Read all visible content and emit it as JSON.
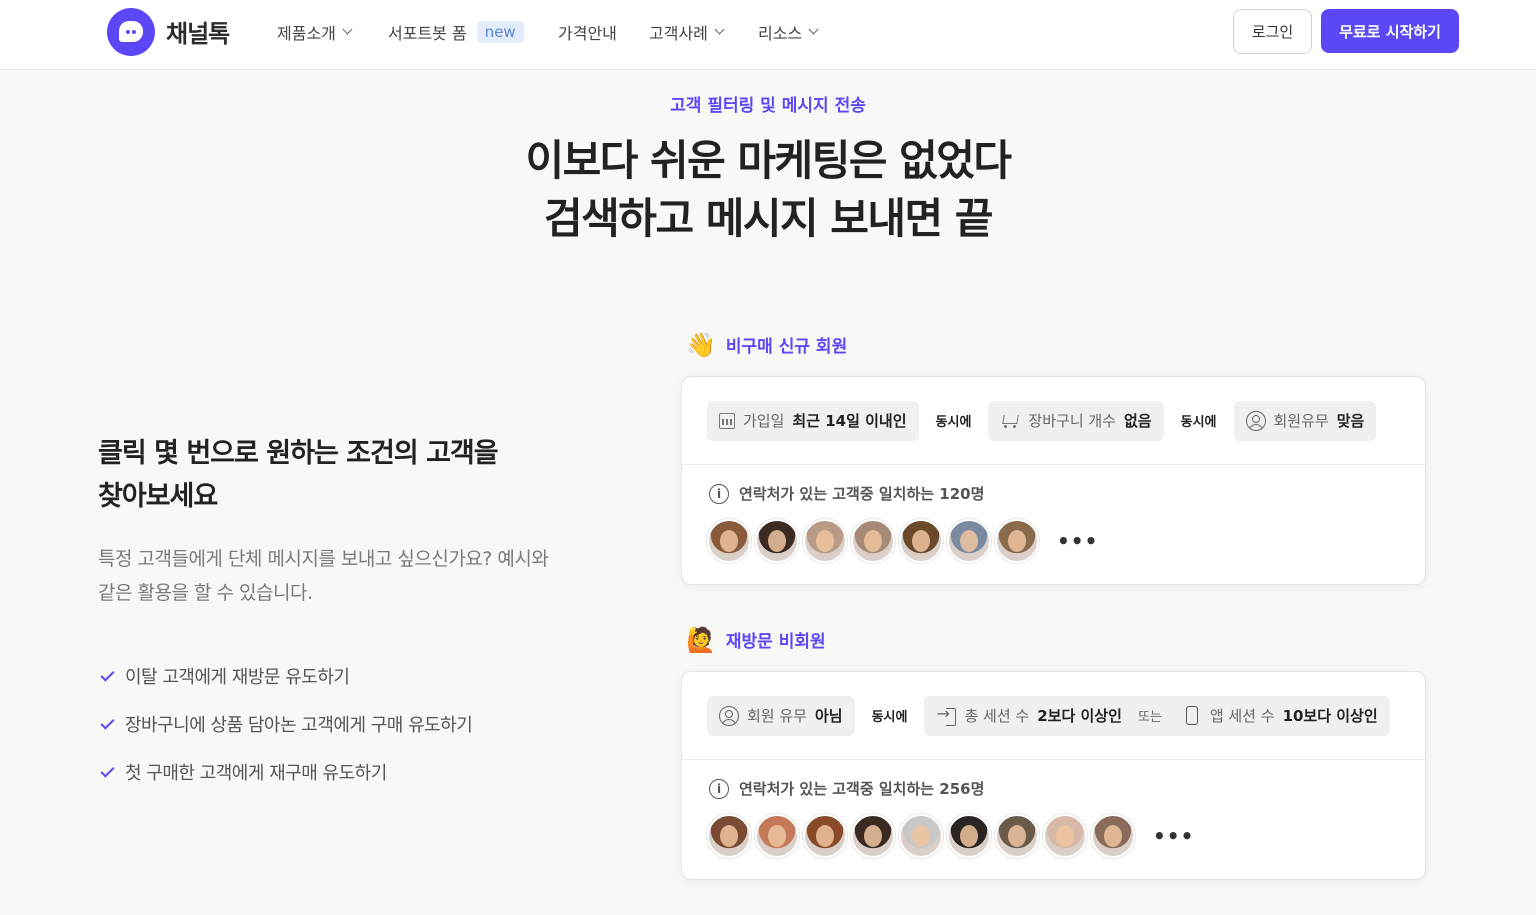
{
  "header": {
    "logo_text": "채널톡",
    "nav": [
      {
        "label": "제품소개",
        "has_dropdown": true
      },
      {
        "label": "서포트봇 폼",
        "badge": "new"
      },
      {
        "label": "가격안내"
      },
      {
        "label": "고객사례",
        "has_dropdown": true
      },
      {
        "label": "리소스",
        "has_dropdown": true
      }
    ],
    "login_label": "로그인",
    "start_label": "무료로 시작하기",
    "accent_color": "#5b47f5"
  },
  "hero": {
    "eyebrow": "고객 필터링 및 메시지 전송",
    "line1": "이보다 쉬운 마케팅은 없었다",
    "line2": "검색하고 메시지 보내면 끝"
  },
  "left": {
    "title_line1": "클릭 몇 번으로 원하는 조건의 고객을",
    "title_line2": "찾아보세요",
    "desc_line1": "특정 고객들에게 단체 메시지를 보내고 싶으신가요? 예시와",
    "desc_line2": "같은 활용을 할 수 있습니다.",
    "checklist": [
      "이탈 고객에게 재방문 유도하기",
      "장바구니에 상품 담아논 고객에게 구매 유도하기",
      "첫 구매한 고객에게 재구매 유도하기"
    ]
  },
  "segments": [
    {
      "emoji": "👋",
      "emoji_name": "waving-hand-icon",
      "title": "비구매 신규 회원",
      "filters": [
        {
          "icon": "calendar-icon",
          "key": "가입일",
          "value": "최근 14일 이내인"
        },
        {
          "icon": "cart-icon",
          "key": "장바구니 개수",
          "value": "없음"
        },
        {
          "icon": "user-circle-icon",
          "key": "회원유무",
          "value": "맞음"
        }
      ],
      "conjunction": "동시에",
      "match_text": "연락처가 있는 고객중 일치하는 120명",
      "avatar_colors": [
        "#8a5a3c",
        "#3b2a22",
        "#b89a86",
        "#a88a78",
        "#6b4a2c",
        "#7a8aa0",
        "#8a6a4c"
      ],
      "more": "•••"
    },
    {
      "emoji": "🙋",
      "emoji_name": "raising-hand-icon",
      "title": "재방문 비회원",
      "filters": [
        {
          "icon": "user-circle-icon",
          "key": "회원 유무",
          "value": "아님"
        },
        {
          "icon": "enter-icon",
          "key": "총 세션 수",
          "value": "2보다 이상인",
          "or": "또는",
          "icon2": "phone-icon",
          "key2": "앱 세션 수",
          "value2": "10보다 이상인"
        }
      ],
      "conjunction": "동시에",
      "match_text": "연락처가 있는 고객중 일치하는 256명",
      "avatar_colors": [
        "#7a4a32",
        "#c47a58",
        "#8a4a2a",
        "#3a2a22",
        "#c8c8c8",
        "#2a2422",
        "#6a5a4a",
        "#d8b8a8",
        "#8a6a5a"
      ],
      "more": "•••"
    }
  ]
}
